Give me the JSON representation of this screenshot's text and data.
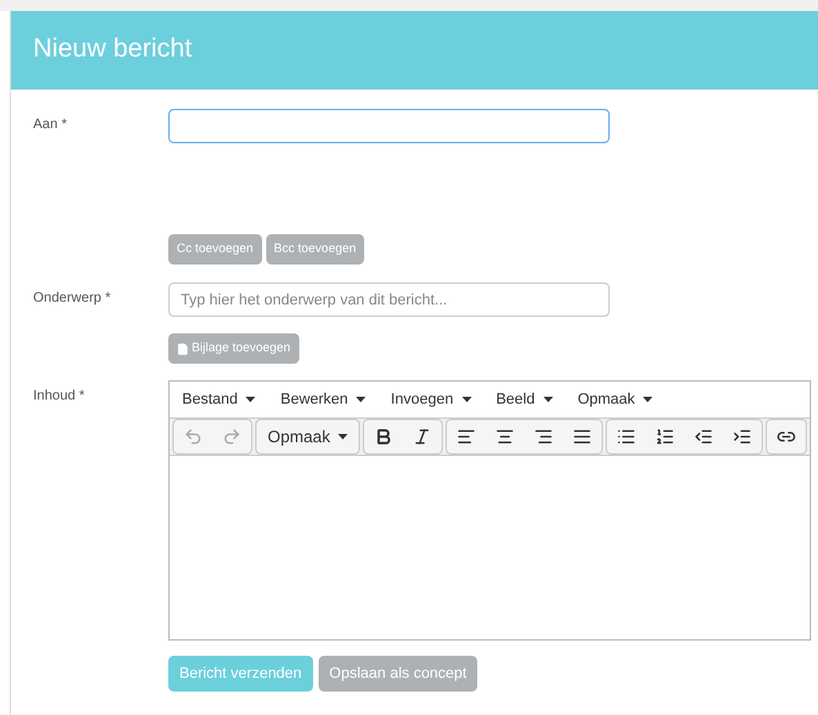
{
  "header": {
    "title": "Nieuw bericht"
  },
  "fields": [
    {
      "kind": "input",
      "label": "Aan *",
      "focused": true
    },
    {
      "kind": "buttons",
      "buttons": [
        "Cc toevoegen",
        "Bcc toevoegen"
      ]
    },
    {
      "kind": "input",
      "label": "Onderwerp *",
      "placeholder": "Typ hier het onderwerp van dit bericht...",
      "focused": false
    },
    {
      "kind": "attach",
      "button": "Bijlage toevoegen"
    },
    {
      "kind": "editor",
      "label": "Inhoud *"
    }
  ],
  "editor": {
    "menus": [
      "Bestand",
      "Bewerken",
      "Invoegen",
      "Beeld",
      "Opmaak"
    ],
    "toolbar": [
      [
        {
          "kind": "undo",
          "disabled": true
        },
        {
          "kind": "redo",
          "disabled": true
        }
      ],
      [
        {
          "kind": "dropdown",
          "label": "Opmaak",
          "disabled": false
        }
      ],
      [
        {
          "kind": "bold",
          "disabled": false
        },
        {
          "kind": "italic",
          "disabled": false
        }
      ],
      [
        {
          "kind": "align-left",
          "disabled": false
        },
        {
          "kind": "align-center",
          "disabled": false
        },
        {
          "kind": "align-right",
          "disabled": false
        },
        {
          "kind": "justify",
          "disabled": false
        }
      ],
      [
        {
          "kind": "bullets",
          "disabled": false
        },
        {
          "kind": "numbers",
          "disabled": false
        },
        {
          "kind": "outdent",
          "disabled": false
        },
        {
          "kind": "indent",
          "disabled": false
        }
      ],
      [
        {
          "kind": "link",
          "disabled": false
        }
      ]
    ]
  },
  "actions": [
    {
      "label": "Bericht verzenden",
      "primary": true
    },
    {
      "label": "Opslaan als concept",
      "primary": false
    }
  ]
}
